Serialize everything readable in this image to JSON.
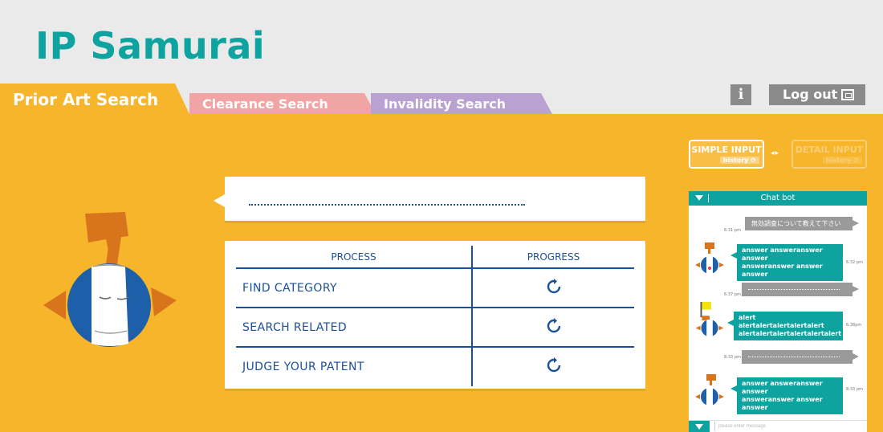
{
  "app": {
    "title": "IP Samurai"
  },
  "tabs": [
    {
      "label": "Prior Art Search",
      "active": true
    },
    {
      "label": "Clearance Search",
      "active": false
    },
    {
      "label": "Invalidity Search",
      "active": false
    }
  ],
  "header_actions": {
    "info_label": "i",
    "logout_label": "Log out"
  },
  "mode": {
    "simple_label": "SIMPLE INPUT",
    "detail_label": "DETAIL INPUT",
    "history_label": "history ⟳",
    "selected": "SIMPLE INPUT"
  },
  "search": {
    "value": ""
  },
  "progress_table": {
    "headers": [
      "PROCESS",
      "PROGRESS"
    ],
    "rows": [
      {
        "process": "FIND CATEGORY",
        "status_icon": "refresh-icon"
      },
      {
        "process": "SEARCH RELATED",
        "status_icon": "refresh-icon"
      },
      {
        "process": "JUDGE YOUR PATENT",
        "status_icon": "refresh-icon"
      }
    ]
  },
  "chat": {
    "title": "Chat bot",
    "placeholder": "please enter message",
    "messages": [
      {
        "from": "user",
        "text": "無効調査について教えて下さい",
        "time": "6:31 pm"
      },
      {
        "from": "bot",
        "line1": "answer answeranswer answer",
        "line2": "answeranswer answer answer",
        "time": "6:32 pm"
      },
      {
        "from": "user",
        "text": "",
        "time": "6:37 pm"
      },
      {
        "from": "bot",
        "line1": "alert alertalertalertalertalert",
        "line2": "alertalertalertalertalertalert",
        "time": "6:38pm"
      },
      {
        "from": "user",
        "text": "",
        "time": "8:33 pm"
      },
      {
        "from": "bot",
        "line1": "answer answeranswer answer",
        "line2": "answeranswer answer answer",
        "time": "8:33 pm"
      }
    ]
  },
  "colors": {
    "brand": "#0fa3a0",
    "main_bg": "#f7b52c",
    "clearance_tab": "#f1a4a4",
    "invalidity_tab": "#b9a2d2",
    "table_text": "#1a4f9c"
  }
}
